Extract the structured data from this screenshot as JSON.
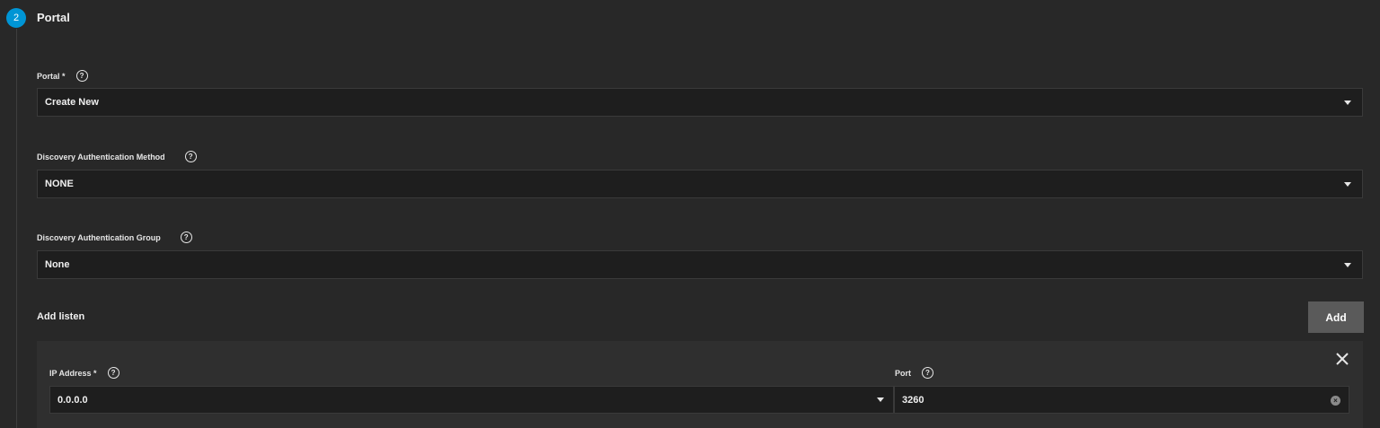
{
  "step": {
    "number": "2",
    "title": "Portal"
  },
  "fields": {
    "portal": {
      "label": "Portal *",
      "value": "Create New"
    },
    "discovery_method": {
      "label": "Discovery Authentication Method",
      "value": "NONE"
    },
    "discovery_group": {
      "label": "Discovery Authentication Group",
      "value": "None"
    }
  },
  "add_listen": {
    "label": "Add listen",
    "button_label": "Add"
  },
  "listen": {
    "ip_label": "IP Address *",
    "ip_value": "0.0.0.0",
    "port_label": "Port",
    "port_value": "3260"
  },
  "colors": {
    "accent": "#0095d5",
    "background": "#282828",
    "field_bg": "#1e1e1e",
    "panel_bg": "#2f2f2f",
    "button_bg": "#5a5a5a"
  },
  "icons": {
    "help": "help-circle-icon",
    "caret": "chevron-down-icon",
    "close": "close-icon",
    "clear": "clear-circle-icon"
  }
}
